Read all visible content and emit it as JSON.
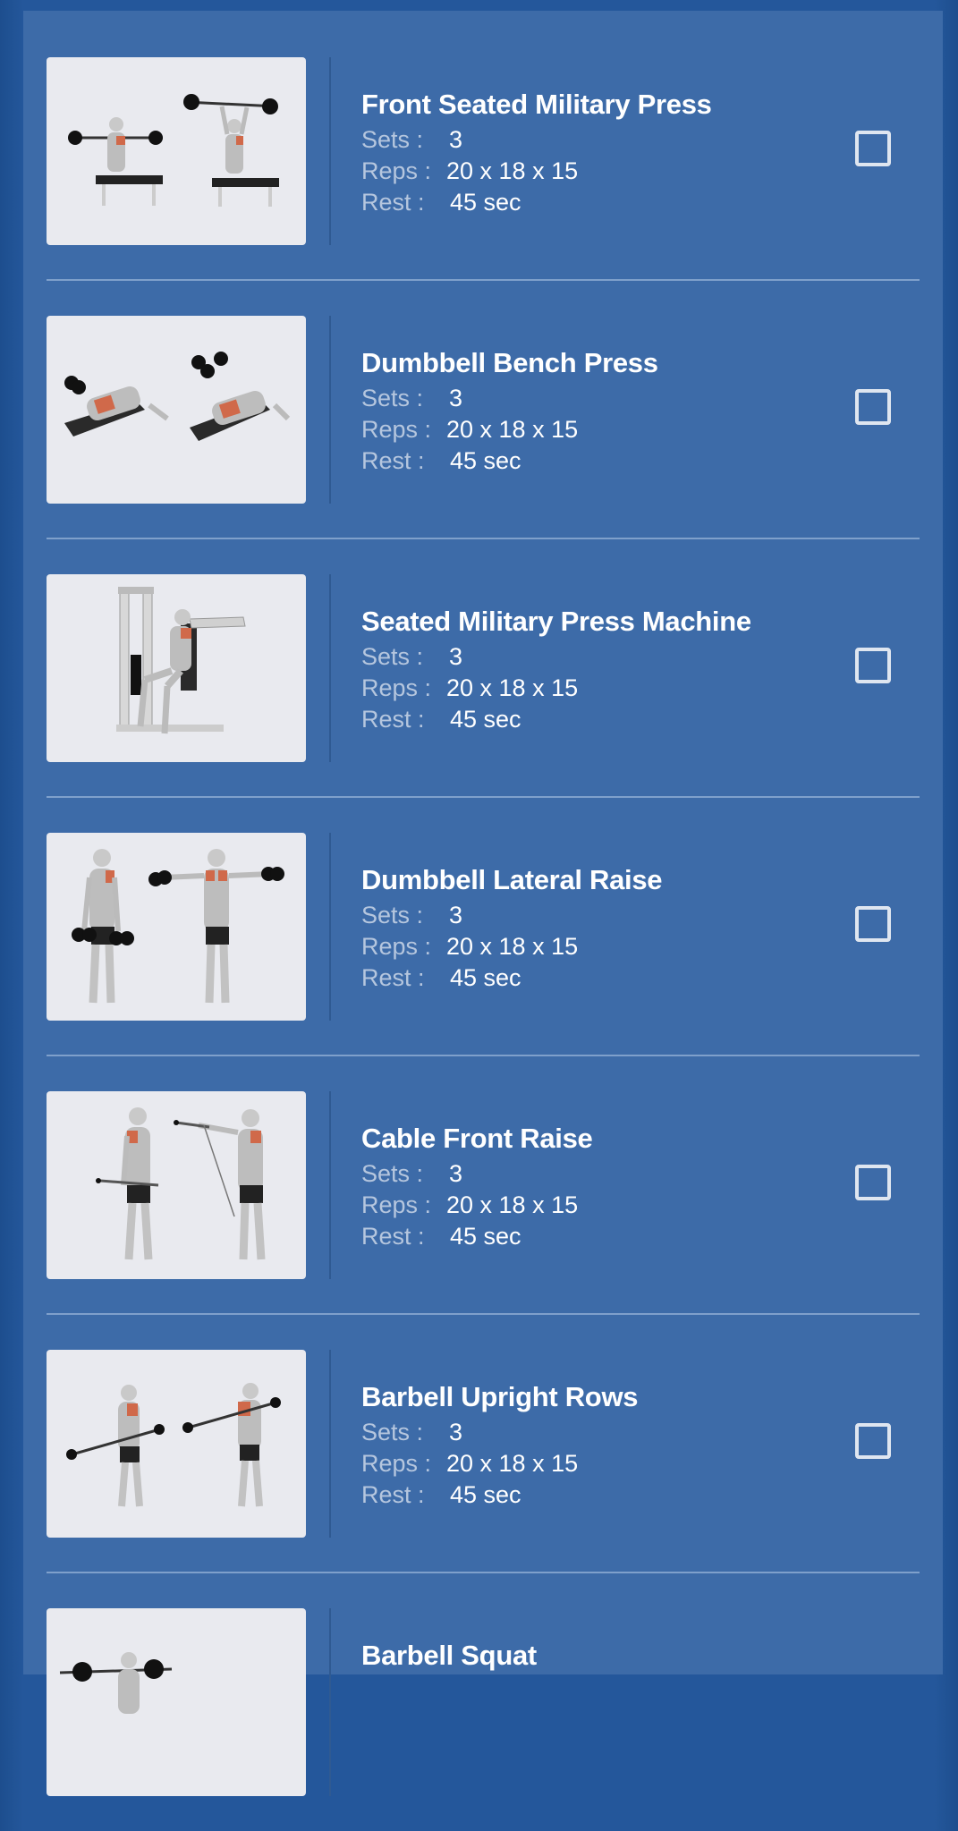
{
  "colors": {
    "background": "#24579b",
    "panel": "#3d6ba8",
    "label": "#b5c6de",
    "title": "#ffffff",
    "divider": "#7fa0cb"
  },
  "labels": {
    "sets": "Sets :",
    "reps": "Reps :",
    "rest": "Rest :"
  },
  "exercises": [
    {
      "name": "Front Seated Military Press",
      "sets": "3",
      "reps": "20 x 18 x 15",
      "rest": "45 sec",
      "checked": false,
      "image_icon": "seated-barbell-press-illustration"
    },
    {
      "name": "Dumbbell Bench Press",
      "sets": "3",
      "reps": "20 x 18 x 15",
      "rest": "45 sec",
      "checked": false,
      "image_icon": "dumbbell-bench-press-illustration"
    },
    {
      "name": "Seated Military Press Machine",
      "sets": "3",
      "reps": "20 x 18 x 15",
      "rest": "45 sec",
      "checked": false,
      "image_icon": "press-machine-illustration"
    },
    {
      "name": "Dumbbell Lateral Raise",
      "sets": "3",
      "reps": "20 x 18 x 15",
      "rest": "45 sec",
      "checked": false,
      "image_icon": "lateral-raise-illustration"
    },
    {
      "name": "Cable Front Raise",
      "sets": "3",
      "reps": "20 x 18 x 15",
      "rest": "45 sec",
      "checked": false,
      "image_icon": "cable-front-raise-illustration"
    },
    {
      "name": "Barbell Upright Rows",
      "sets": "3",
      "reps": "20 x 18 x 15",
      "rest": "45 sec",
      "checked": false,
      "image_icon": "upright-row-illustration"
    },
    {
      "name": "Barbell Squat",
      "image_icon": "barbell-squat-illustration"
    }
  ]
}
